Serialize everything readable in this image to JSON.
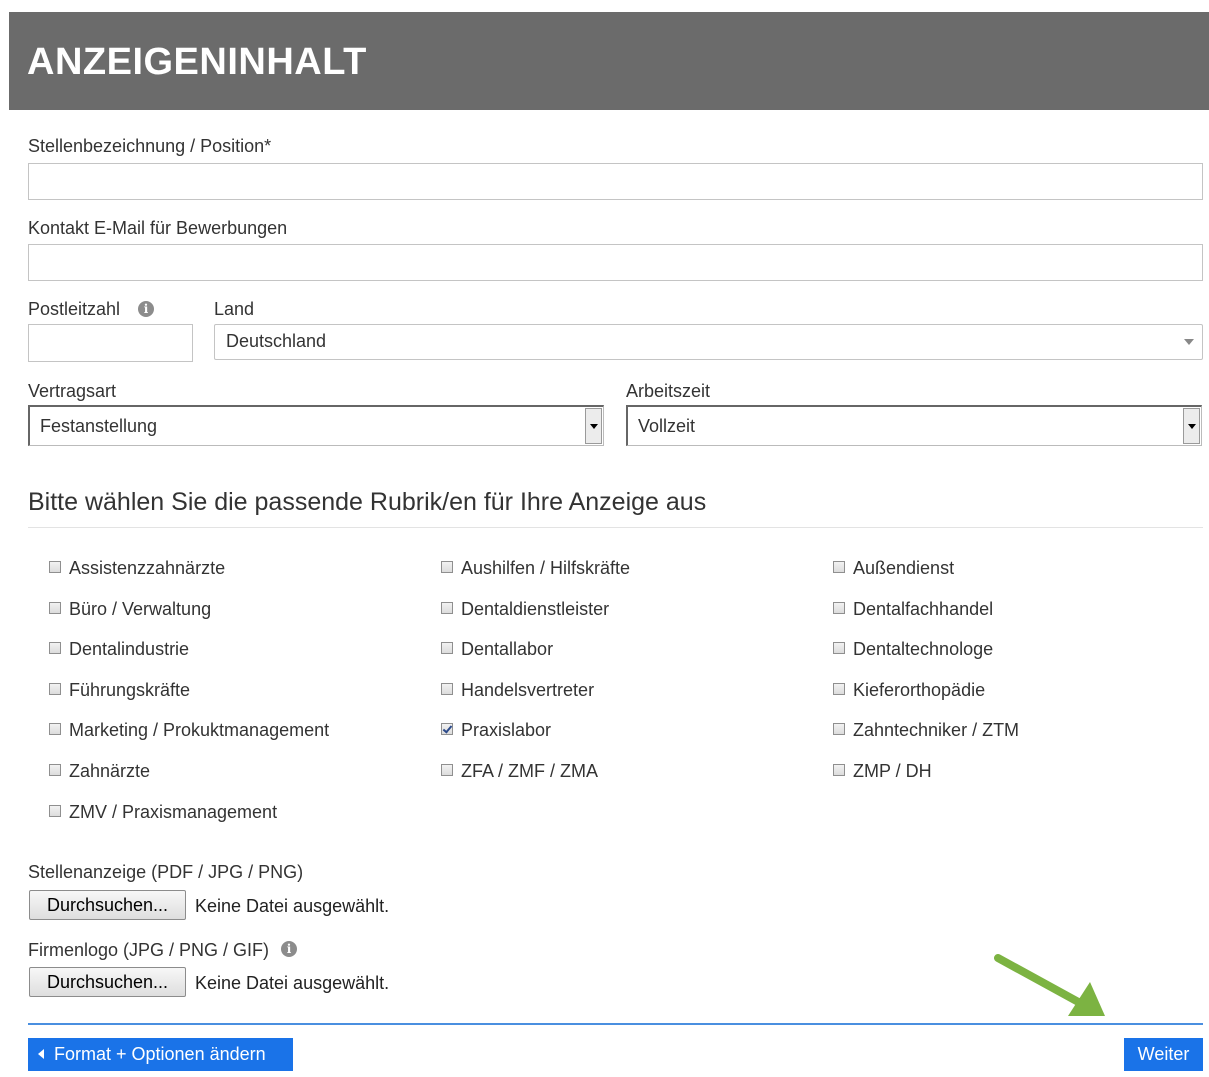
{
  "header": {
    "title": "ANZEIGENINHALT"
  },
  "fields": {
    "position_label": "Stellenbezeichnung / Position*",
    "position_value": "",
    "email_label": "Kontakt E-Mail für Bewerbungen",
    "email_value": "",
    "postal_label": "Postleitzahl",
    "postal_value": "",
    "country_label": "Land",
    "country_value": "Deutschland",
    "contract_label": "Vertragsart",
    "contract_value": "Festanstellung",
    "worktime_label": "Arbeitszeit",
    "worktime_value": "Vollzeit"
  },
  "categories": {
    "title": "Bitte wählen Sie die passende Rubrik/en für Ihre Anzeige aus",
    "items": [
      {
        "label": "Assistenzzahnärzte",
        "checked": false
      },
      {
        "label": "Aushilfen / Hilfskräfte",
        "checked": false
      },
      {
        "label": "Außendienst",
        "checked": false
      },
      {
        "label": "Büro / Verwaltung",
        "checked": false
      },
      {
        "label": "Dentaldienstleister",
        "checked": false
      },
      {
        "label": "Dentalfachhandel",
        "checked": false
      },
      {
        "label": "Dentalindustrie",
        "checked": false
      },
      {
        "label": "Dentallabor",
        "checked": false
      },
      {
        "label": "Dentaltechnologe",
        "checked": false
      },
      {
        "label": "Führungskräfte",
        "checked": false
      },
      {
        "label": "Handelsvertreter",
        "checked": false
      },
      {
        "label": "Kieferorthopädie",
        "checked": false
      },
      {
        "label": "Marketing / Prokuktmanagement",
        "checked": false
      },
      {
        "label": "Praxislabor",
        "checked": true
      },
      {
        "label": "Zahntechniker / ZTM",
        "checked": false
      },
      {
        "label": "Zahnärzte",
        "checked": false
      },
      {
        "label": "ZFA / ZMF / ZMA",
        "checked": false
      },
      {
        "label": "ZMP / DH",
        "checked": false
      },
      {
        "label": "ZMV / Praxismanagement",
        "checked": false
      }
    ]
  },
  "uploads": {
    "ad_label": "Stellenanzeige (PDF / JPG / PNG)",
    "ad_button": "Durchsuchen...",
    "ad_status": "Keine Datei ausgewählt.",
    "logo_label": "Firmenlogo (JPG / PNG / GIF)",
    "logo_button": "Durchsuchen...",
    "logo_status": "Keine Datei ausgewählt."
  },
  "footer": {
    "back_label": "Format + Optionen ändern",
    "next_label": "Weiter"
  },
  "icons": {
    "info": "info-icon",
    "back_arrow": "chevron-left-icon",
    "pointer": "green-arrow-icon"
  },
  "colors": {
    "header_bg": "#6b6b6b",
    "button_blue": "#1a73e8",
    "pointer_green": "#7cb342"
  }
}
